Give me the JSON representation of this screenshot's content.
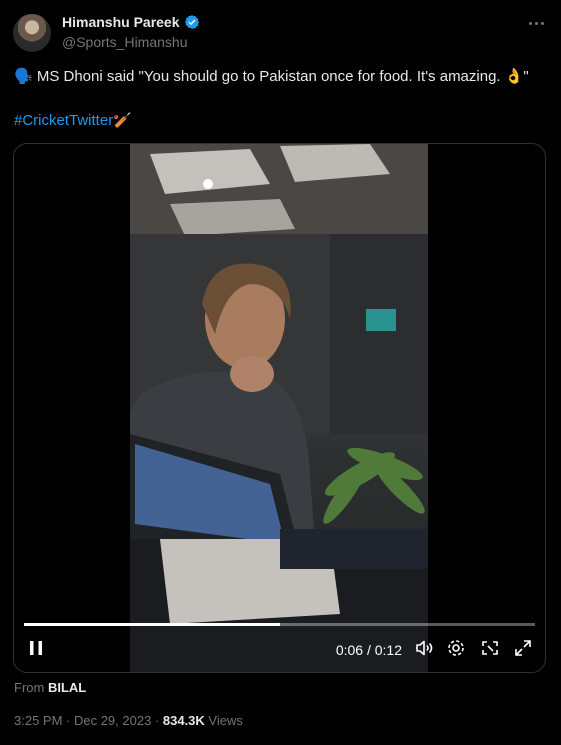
{
  "author": {
    "name": "Himanshu Pareek",
    "handle": "@Sports_Himanshu",
    "verified_color": "#1d9bf0"
  },
  "tweet": {
    "text": "🗣️ MS Dhoni said \"You should go to Pakistan once for food. It's amazing. 👌\"",
    "hashtag": "#CricketTwitter",
    "hashtag_emoji": "🏏"
  },
  "video": {
    "time": "0:06 / 0:12",
    "progress": 0.5,
    "icons": [
      "pause-icon",
      "volume-icon",
      "settings-icon",
      "pip-icon",
      "fullscreen-icon"
    ]
  },
  "attribution": {
    "prefix": "From",
    "source": "BILAL"
  },
  "meta": {
    "timestamp": "3:25 PM · Dec 29, 2023",
    "separator": " · ",
    "views_count": "834.3K",
    "views_label": "Views"
  }
}
